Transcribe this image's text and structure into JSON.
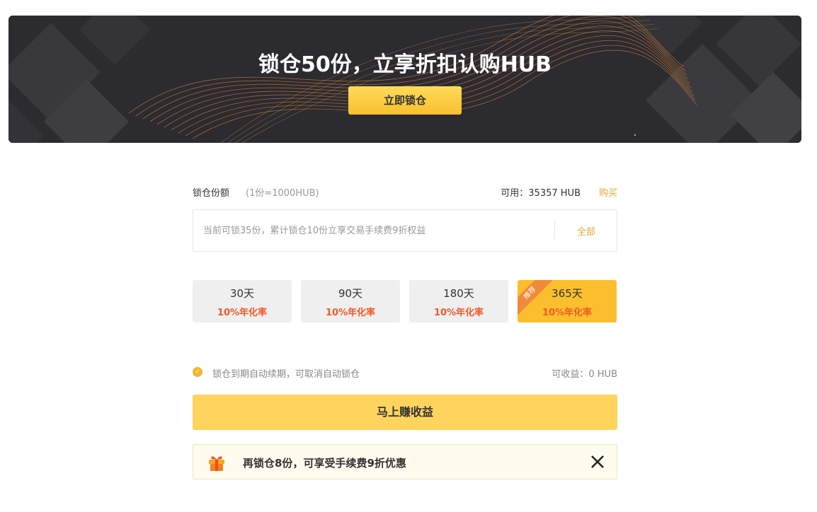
{
  "banner": {
    "title": "锁仓50份，立享折扣认购HUB",
    "button_label": "立即锁仓"
  },
  "form": {
    "label": "锁仓份额",
    "unit_hint": "(1份=1000HUB)",
    "available": "可用：35357 HUB",
    "buy_link": "购买",
    "input_placeholder": "当前可锁35份，累计锁仓10份立享交易手续费9折权益",
    "all_button": "全部"
  },
  "periods": [
    {
      "days": "30天",
      "rate": "10%年化率"
    },
    {
      "days": "90天",
      "rate": "10%年化率"
    },
    {
      "days": "180天",
      "rate": "10%年化率"
    },
    {
      "days": "365天",
      "rate": "10%年化率",
      "badge": "推荐"
    }
  ],
  "renew": {
    "text": "锁仓到期自动续期，可取消自动锁仓",
    "earnings": "可收益：0 HUB"
  },
  "cta_label": "马上赚收益",
  "notice": {
    "text": "再锁仓8份，可享受手续费9折优惠"
  },
  "colors": {
    "accent": "#fbbf2d",
    "link": "#e8a735",
    "rate": "#f05a28",
    "cta": "#ffd45e"
  }
}
